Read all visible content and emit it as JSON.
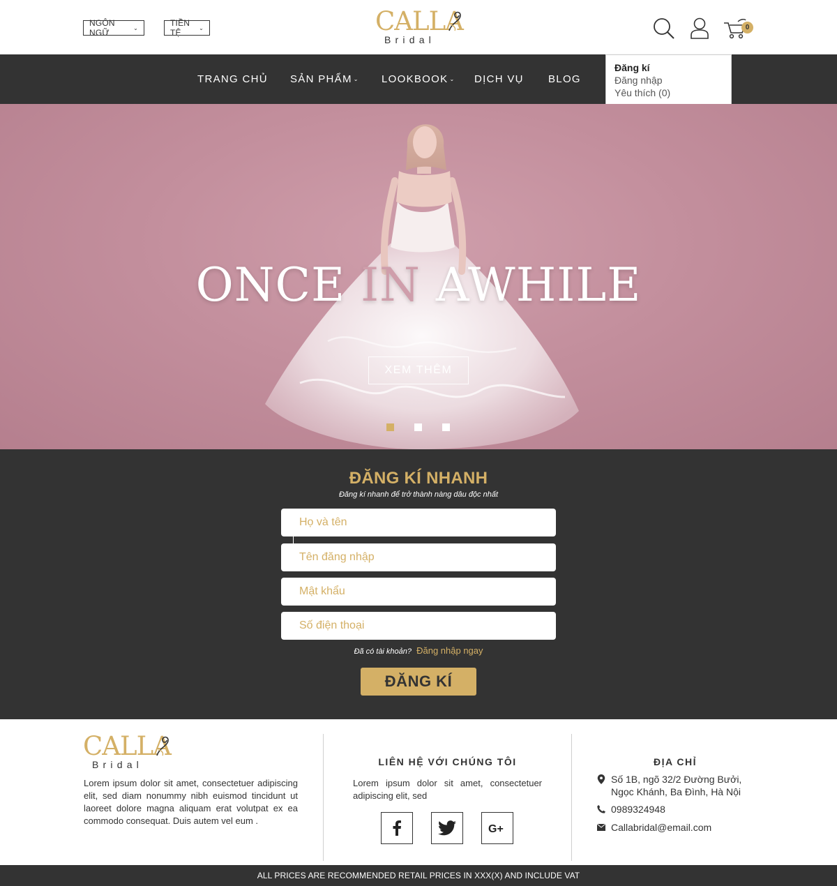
{
  "header": {
    "language_label": "NGÔN NGỮ",
    "currency_label": "TIỀN TỆ",
    "logo_word": "CALLA",
    "logo_sub": "Bridal",
    "cart_count": "0"
  },
  "account_menu": {
    "items": [
      "Đăng kí",
      "Đăng nhập",
      "Yêu thích (0)"
    ]
  },
  "nav": {
    "items": [
      "TRANG CHỦ",
      "SẢN PHẨM",
      "LOOKBOOK",
      "DỊCH VỤ",
      "BLOG"
    ]
  },
  "hero": {
    "title_part1": "ONCE ",
    "title_accent": "IN",
    "title_part2": " AWHILE",
    "button_label": "XEM THÊM",
    "slides_total": 3,
    "active_slide": 1,
    "background_color": "#c9929f"
  },
  "quick_register": {
    "title": "ĐĂNG KÍ NHANH",
    "subtitle": "Đăng kí nhanh để trở thành nàng dâu độc nhất",
    "fields": {
      "full_name_placeholder": "Họ và tên",
      "username_placeholder": "Tên đăng nhập",
      "password_placeholder": "Mật khẩu",
      "phone_placeholder": "Số điện thoại"
    },
    "have_account_text": "Đã có tài khoản?",
    "login_link": "Đăng nhập ngay",
    "submit_label": "ĐĂNG KÍ"
  },
  "footer": {
    "about_text": "Lorem ipsum dolor sit amet, consectetuer adipiscing elit, sed diam nonummy nibh euismod tincidunt ut laoreet dolore magna aliquam erat volutpat ex ea commodo consequat. Duis autem vel eum .",
    "contact_heading": "LIÊN HỆ VỚI CHÚNG TÔI",
    "contact_text": "Lorem ipsum dolor sit amet, consectetuer adipiscing elit, sed",
    "social_icons": [
      "facebook-icon",
      "twitter-icon",
      "google-plus-icon"
    ],
    "address_heading": "ĐỊA CHỈ",
    "address_line1": "Số 1B, ngõ 32/2 Đường Bưởi,",
    "address_line2": "Ngọc Khánh, Ba Đình, Hà Nội",
    "phone": "0989324948",
    "email": "Callabridal@email.com"
  },
  "bottom_bar": {
    "text": "ALL PRICES ARE RECOMMENDED RETAIL PRICES IN XXX(X) AND INCLUDE VAT"
  },
  "colors": {
    "accent_gold": "#d4b066",
    "dark": "#333333",
    "hero_pink": "#c9929f"
  }
}
